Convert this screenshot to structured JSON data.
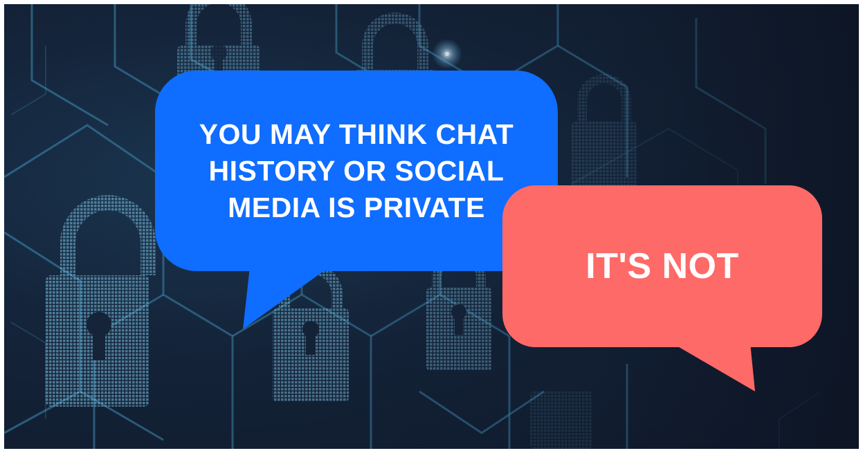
{
  "message_left": {
    "lines": [
      "YOU MAY THINK CHAT",
      "HISTORY OR SOCIAL",
      "MEDIA IS PRIVATE"
    ],
    "color": "#0f6dff"
  },
  "message_right": {
    "text": "IT'S NOT",
    "color": "#fe6a67"
  },
  "background": {
    "color": "#111c2e",
    "accent": "#3fb4d9"
  }
}
